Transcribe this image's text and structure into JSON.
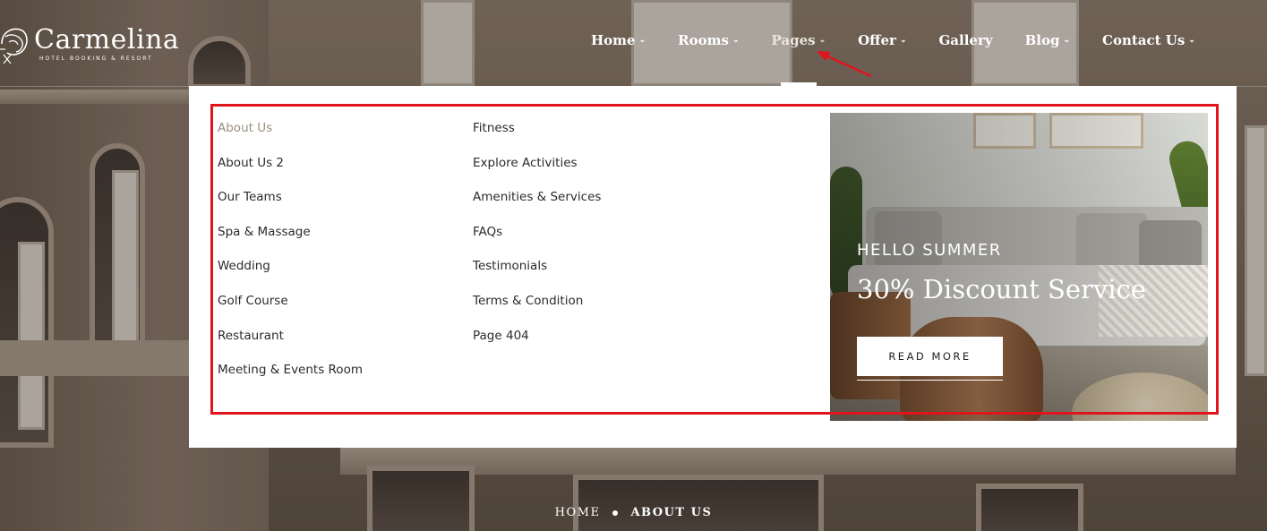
{
  "brand": {
    "name": "Carmelina",
    "tagline": "HOTEL BOOKING & RESORT"
  },
  "nav": {
    "items": [
      {
        "label": "Home"
      },
      {
        "label": "Rooms"
      },
      {
        "label": "Pages"
      },
      {
        "label": "Offer"
      },
      {
        "label": "Gallery"
      },
      {
        "label": "Blog"
      },
      {
        "label": "Contact Us"
      }
    ],
    "active": "Pages"
  },
  "mega_menu": {
    "column_1": [
      "About Us",
      "About Us 2",
      "Our Teams",
      "Spa & Massage",
      "Wedding",
      "Golf Course",
      "Restaurant",
      "Meeting & Events Room"
    ],
    "column_2": [
      "Fitness",
      "Explore Activities",
      "Amenities & Services",
      "FAQs",
      "Testimonials",
      "Terms & Condition",
      "Page 404"
    ],
    "current_item": "About Us",
    "promo": {
      "kicker": "HELLO SUMMER",
      "title": "30% Discount Service",
      "button": "READ MORE"
    }
  },
  "breadcrumb": {
    "home": "HOME",
    "current": "ABOUT US"
  },
  "colors": {
    "highlight": "#e0141c",
    "menu_text": "#2b2b2b",
    "menu_current": "#9a8e82"
  }
}
